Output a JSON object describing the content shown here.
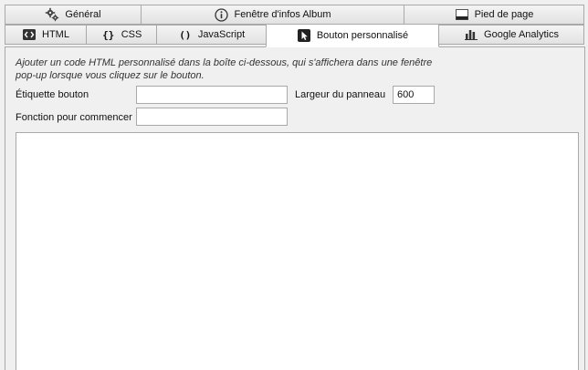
{
  "tabs_row1": [
    {
      "label": "Général",
      "icon": "gear-icon"
    },
    {
      "label": "Fenêtre d'infos Album",
      "icon": "info-icon"
    },
    {
      "label": "Pied de page",
      "icon": "footer-icon"
    }
  ],
  "tabs_row2": [
    {
      "label": "HTML",
      "icon": "code-icon"
    },
    {
      "label": "CSS",
      "icon": "braces-icon"
    },
    {
      "label": "JavaScript",
      "icon": "parentheses-icon"
    },
    {
      "label": "Bouton personnalisé",
      "icon": "cursor-icon"
    },
    {
      "label": "Google Analytics",
      "icon": "bar-chart-icon"
    }
  ],
  "description": "Ajouter un code HTML personnalisé dans la boîte ci-dessous, qui s'affichera dans une fenêtre pop-up lorsque vous cliquez sur le bouton.",
  "form": {
    "button_label": {
      "label": "Étiquette bouton",
      "value": ""
    },
    "panel_width": {
      "label": "Largeur du panneau",
      "value": "600"
    },
    "start_function": {
      "label": "Fonction pour commencer",
      "value": ""
    }
  },
  "editor": {
    "content": ""
  }
}
